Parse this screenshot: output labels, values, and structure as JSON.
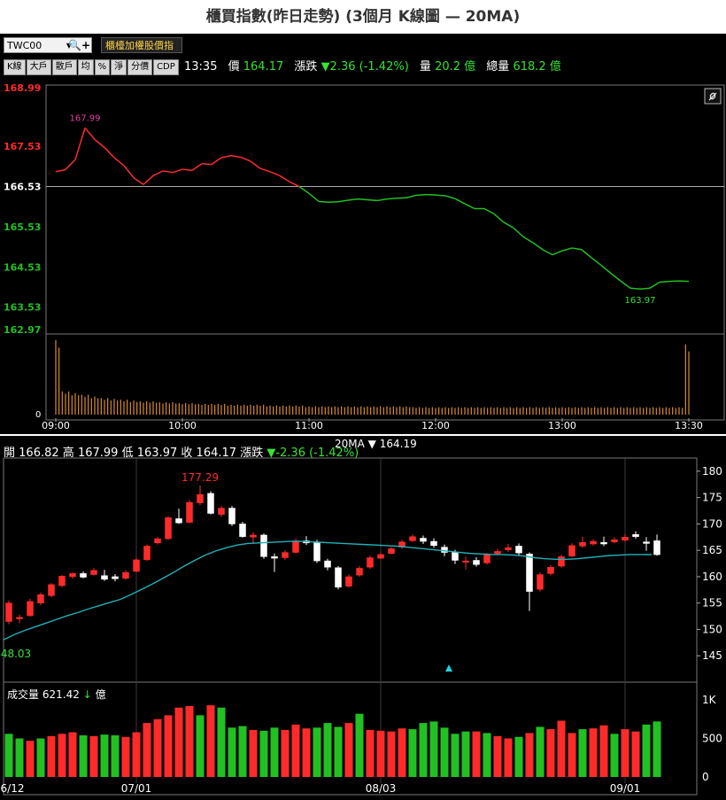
{
  "title": "櫃買指數(昨日走勢) (3個月 K線圖 — 20MA)",
  "toolbar": {
    "symbol": "TWC00",
    "dropdown_icon": "▼",
    "search_icon": "🔍",
    "add_icon": "+",
    "index_name": "櫃檯加權股價指",
    "buttons": [
      "K線",
      "大戶",
      "散戶",
      "均",
      "%",
      "淨",
      "分價",
      "CDP"
    ],
    "time": "13:35",
    "price_label": "價",
    "price": "164.17",
    "change_label": "漲跌",
    "change": "▼2.36 (-1.42%)",
    "qty_label": "量",
    "qty": "20.2 億",
    "total_label": "總量",
    "total": "618.2 億"
  },
  "link_icon": "link-icon",
  "ohlc": {
    "open_label": "開",
    "open": "166.82",
    "high_label": "高",
    "high": "167.99",
    "low_label": "低",
    "low": "163.97",
    "close_label": "收",
    "close": "164.17",
    "change_label": "漲跌",
    "change": "▼-2.36 (-1.42%)",
    "ma_legend": "20MA",
    "ma_marker": "▼",
    "ma_value": "164.19"
  },
  "volume_header": {
    "label": "成交量",
    "value": "621.42",
    "arrow": "↓",
    "unit": "億"
  },
  "colors": {
    "up": "#ff2b2b",
    "down": "#22c022",
    "ma": "#22b0b8",
    "vol_intraday": "#d98c2b",
    "ref": "#ffffff"
  },
  "chart_data": [
    {
      "type": "line",
      "name": "intraday",
      "x_ticks": [
        "09:00",
        "10:00",
        "11:00",
        "12:00",
        "13:00",
        "13:30"
      ],
      "y_ticks": [
        "168.99",
        "167.53",
        "166.53",
        "165.53",
        "164.53",
        "163.53",
        "162.97"
      ],
      "ylim": [
        162.97,
        168.99
      ],
      "reference": 166.53,
      "high_label": "167.99",
      "low_label": "163.97",
      "volume_axis_label": "0",
      "price": [
        166.9,
        166.95,
        167.2,
        167.99,
        167.7,
        167.5,
        167.25,
        167.05,
        166.75,
        166.58,
        166.8,
        166.92,
        166.88,
        166.96,
        166.93,
        167.1,
        167.08,
        167.25,
        167.3,
        167.26,
        167.16,
        166.98,
        166.9,
        166.8,
        166.65,
        166.53,
        166.36,
        166.16,
        166.14,
        166.15,
        166.19,
        166.22,
        166.2,
        166.18,
        166.22,
        166.24,
        166.25,
        166.31,
        166.33,
        166.32,
        166.3,
        166.23,
        166.1,
        165.98,
        165.98,
        165.85,
        165.64,
        165.5,
        165.28,
        165.13,
        164.96,
        164.83,
        164.93,
        165.0,
        164.96,
        164.76,
        164.57,
        164.37,
        164.18,
        164.0,
        163.98,
        164.0,
        164.15,
        164.17,
        164.18,
        164.17
      ],
      "volume": [
        0.9,
        0.28,
        0.26,
        0.24,
        0.22,
        0.2,
        0.19,
        0.18,
        0.17,
        0.16,
        0.16,
        0.15,
        0.15,
        0.14,
        0.14,
        0.13,
        0.13,
        0.13,
        0.12,
        0.12,
        0.12,
        0.12,
        0.11,
        0.11,
        0.11,
        0.11,
        0.1,
        0.1,
        0.1,
        0.1,
        0.1,
        0.1,
        0.1,
        0.1,
        0.1,
        0.1,
        0.1,
        0.09,
        0.09,
        0.09,
        0.09,
        0.09,
        0.09,
        0.09,
        0.09,
        0.09,
        0.09,
        0.09,
        0.09,
        0.09,
        0.09,
        0.09,
        0.09,
        0.09,
        0.09,
        0.09,
        0.09,
        0.09,
        0.09,
        0.09,
        0.09,
        0.09,
        0.09,
        0.09,
        0.09,
        0.85
      ]
    },
    {
      "type": "candlestick",
      "name": "daily",
      "x_ticks": [
        "6/12",
        "07/01",
        "08/03",
        "09/01"
      ],
      "y_ticks": [
        "180",
        "175",
        "170",
        "165",
        "160",
        "155",
        "150",
        "145"
      ],
      "ylim": [
        141,
        182
      ],
      "max_label": "177.29",
      "min_label": "48.03",
      "volume_ticks": [
        "1K",
        "500",
        "0"
      ],
      "volume_ylim": [
        0,
        1000
      ],
      "candles": [
        {
          "o": 151.5,
          "c": 155.0,
          "h": 155.5,
          "l": 151.0
        },
        {
          "o": 152.0,
          "c": 152.3,
          "h": 152.8,
          "l": 151.2
        },
        {
          "o": 152.6,
          "c": 155.3,
          "h": 155.8,
          "l": 152.4
        },
        {
          "o": 155.0,
          "c": 156.6,
          "h": 157.0,
          "l": 154.6
        },
        {
          "o": 156.4,
          "c": 158.5,
          "h": 158.8,
          "l": 156.1
        },
        {
          "o": 158.3,
          "c": 160.1,
          "h": 160.3,
          "l": 158.0
        },
        {
          "o": 160.0,
          "c": 160.6,
          "h": 160.8,
          "l": 159.6
        },
        {
          "o": 160.6,
          "c": 159.9,
          "h": 161.0,
          "l": 159.7
        },
        {
          "o": 160.4,
          "c": 161.2,
          "h": 161.6,
          "l": 160.2
        },
        {
          "o": 160.2,
          "c": 159.5,
          "h": 161.3,
          "l": 159.2
        },
        {
          "o": 160.0,
          "c": 159.6,
          "h": 160.5,
          "l": 159.1
        },
        {
          "o": 159.7,
          "c": 160.8,
          "h": 161.2,
          "l": 159.4
        },
        {
          "o": 161.0,
          "c": 163.2,
          "h": 163.6,
          "l": 160.8
        },
        {
          "o": 163.2,
          "c": 165.8,
          "h": 166.1,
          "l": 163.0
        },
        {
          "o": 166.4,
          "c": 167.2,
          "h": 167.5,
          "l": 166.1
        },
        {
          "o": 167.2,
          "c": 171.2,
          "h": 171.5,
          "l": 167.0
        },
        {
          "o": 171.0,
          "c": 170.2,
          "h": 172.9,
          "l": 170.0
        },
        {
          "o": 170.3,
          "c": 174.1,
          "h": 174.5,
          "l": 170.1
        },
        {
          "o": 174.0,
          "c": 175.6,
          "h": 177.29,
          "l": 173.6
        },
        {
          "o": 175.8,
          "c": 172.0,
          "h": 176.2,
          "l": 171.8
        },
        {
          "o": 171.8,
          "c": 173.0,
          "h": 173.4,
          "l": 171.4
        },
        {
          "o": 173.0,
          "c": 170.0,
          "h": 173.4,
          "l": 169.6
        },
        {
          "o": 170.0,
          "c": 167.6,
          "h": 170.4,
          "l": 167.4
        },
        {
          "o": 167.5,
          "c": 167.9,
          "h": 168.4,
          "l": 166.2
        },
        {
          "o": 167.9,
          "c": 163.8,
          "h": 168.2,
          "l": 163.4
        },
        {
          "o": 163.8,
          "c": 163.5,
          "h": 164.4,
          "l": 160.9
        },
        {
          "o": 163.6,
          "c": 164.6,
          "h": 165.0,
          "l": 163.2
        },
        {
          "o": 164.6,
          "c": 166.8,
          "h": 167.2,
          "l": 164.4
        },
        {
          "o": 166.8,
          "c": 166.4,
          "h": 167.7,
          "l": 166.0
        },
        {
          "o": 166.6,
          "c": 163.0,
          "h": 167.0,
          "l": 162.6
        },
        {
          "o": 163.0,
          "c": 161.8,
          "h": 163.4,
          "l": 161.2
        },
        {
          "o": 161.7,
          "c": 158.0,
          "h": 162.0,
          "l": 157.6
        },
        {
          "o": 158.2,
          "c": 160.0,
          "h": 160.4,
          "l": 157.9
        },
        {
          "o": 160.3,
          "c": 161.6,
          "h": 162.0,
          "l": 160.0
        },
        {
          "o": 161.8,
          "c": 163.6,
          "h": 164.0,
          "l": 161.5
        },
        {
          "o": 163.5,
          "c": 164.2,
          "h": 164.6,
          "l": 163.3
        },
        {
          "o": 164.4,
          "c": 165.3,
          "h": 165.6,
          "l": 164.2
        },
        {
          "o": 165.6,
          "c": 166.6,
          "h": 167.0,
          "l": 165.3
        },
        {
          "o": 166.8,
          "c": 167.6,
          "h": 168.0,
          "l": 166.6
        },
        {
          "o": 167.3,
          "c": 166.7,
          "h": 167.8,
          "l": 166.2
        },
        {
          "o": 166.7,
          "c": 165.9,
          "h": 167.3,
          "l": 165.5
        },
        {
          "o": 165.6,
          "c": 164.6,
          "h": 166.1,
          "l": 163.9
        },
        {
          "o": 164.6,
          "c": 163.1,
          "h": 165.1,
          "l": 162.4
        },
        {
          "o": 162.9,
          "c": 163.0,
          "h": 163.8,
          "l": 161.4
        },
        {
          "o": 163.1,
          "c": 162.3,
          "h": 163.7,
          "l": 161.9
        },
        {
          "o": 162.6,
          "c": 164.2,
          "h": 164.5,
          "l": 162.3
        },
        {
          "o": 164.4,
          "c": 164.8,
          "h": 165.3,
          "l": 164.0
        },
        {
          "o": 165.1,
          "c": 165.5,
          "h": 166.2,
          "l": 164.7
        },
        {
          "o": 165.8,
          "c": 164.5,
          "h": 166.3,
          "l": 164.1
        },
        {
          "o": 164.3,
          "c": 157.2,
          "h": 164.6,
          "l": 153.5
        },
        {
          "o": 157.6,
          "c": 160.4,
          "h": 160.8,
          "l": 157.2
        },
        {
          "o": 160.6,
          "c": 161.8,
          "h": 162.2,
          "l": 160.2
        },
        {
          "o": 162.0,
          "c": 163.8,
          "h": 164.2,
          "l": 161.7
        },
        {
          "o": 163.9,
          "c": 165.9,
          "h": 166.3,
          "l": 163.7
        },
        {
          "o": 165.8,
          "c": 166.5,
          "h": 167.6,
          "l": 165.5
        },
        {
          "o": 166.2,
          "c": 166.7,
          "h": 167.1,
          "l": 165.9
        },
        {
          "o": 166.5,
          "c": 166.2,
          "h": 167.6,
          "l": 165.8
        },
        {
          "o": 166.6,
          "c": 167.0,
          "h": 167.5,
          "l": 166.3
        },
        {
          "o": 166.9,
          "c": 167.5,
          "h": 168.1,
          "l": 166.6
        },
        {
          "o": 168.0,
          "c": 167.6,
          "h": 168.6,
          "l": 167.2
        },
        {
          "o": 166.6,
          "c": 166.3,
          "h": 167.5,
          "l": 164.9
        },
        {
          "o": 166.82,
          "c": 164.17,
          "h": 167.99,
          "l": 163.97
        }
      ],
      "ma20": [
        148.03,
        149.0,
        149.8,
        150.5,
        151.2,
        151.9,
        152.6,
        153.2,
        153.9,
        154.5,
        155.1,
        155.7,
        156.6,
        157.6,
        158.6,
        159.7,
        160.8,
        162.0,
        163.1,
        164.1,
        164.9,
        165.5,
        166.0,
        166.3,
        166.4,
        166.5,
        166.6,
        166.7,
        166.7,
        166.6,
        166.5,
        166.4,
        166.3,
        166.2,
        166.1,
        166.0,
        165.9,
        165.8,
        165.6,
        165.4,
        165.2,
        165.0,
        164.8,
        164.6,
        164.4,
        164.3,
        164.2,
        164.2,
        164.1,
        163.9,
        163.6,
        163.4,
        163.3,
        163.3,
        163.4,
        163.6,
        163.8,
        164.0,
        164.1,
        164.2,
        164.2,
        164.19
      ],
      "volumes": [
        560,
        500,
        470,
        500,
        530,
        560,
        580,
        540,
        530,
        550,
        540,
        520,
        580,
        700,
        750,
        800,
        900,
        920,
        800,
        930,
        900,
        640,
        660,
        610,
        600,
        640,
        610,
        680,
        630,
        640,
        700,
        650,
        700,
        820,
        610,
        600,
        590,
        630,
        620,
        700,
        720,
        640,
        560,
        590,
        590,
        570,
        530,
        500,
        520,
        570,
        650,
        620,
        730,
        570,
        620,
        630,
        670,
        560,
        620,
        590,
        680,
        720
      ],
      "volume_colors": [
        "g",
        "g",
        "r",
        "g",
        "r",
        "r",
        "r",
        "g",
        "r",
        "g",
        "g",
        "r",
        "r",
        "r",
        "r",
        "r",
        "r",
        "r",
        "g",
        "r",
        "g",
        "g",
        "g",
        "r",
        "g",
        "g",
        "r",
        "r",
        "r",
        "g",
        "g",
        "g",
        "r",
        "g",
        "r",
        "r",
        "r",
        "r",
        "g",
        "g",
        "g",
        "g",
        "g",
        "g",
        "r",
        "g",
        "r",
        "r",
        "g",
        "r",
        "g",
        "r",
        "r",
        "r",
        "g",
        "r",
        "r",
        "g",
        "r",
        "r",
        "g",
        "g"
      ]
    }
  ]
}
